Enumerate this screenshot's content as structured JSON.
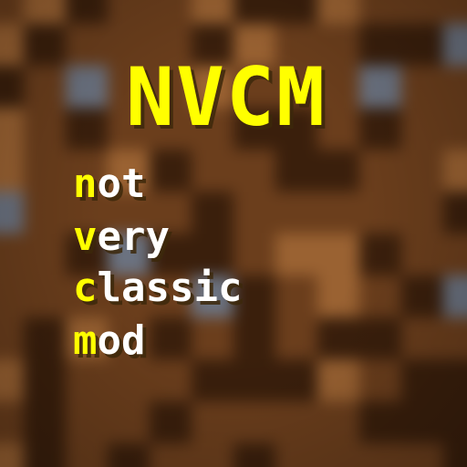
{
  "title": "NVCM",
  "words": [
    {
      "first": "n",
      "rest": "ot"
    },
    {
      "first": "v",
      "rest": "ery"
    },
    {
      "first": "c",
      "rest": "lassic"
    },
    {
      "first": "m",
      "rest": "od"
    }
  ],
  "colors": {
    "title": "#ffff00",
    "accent": "#ffff00",
    "text": "#ffffff",
    "dirt_dark": "#3a1f0c",
    "dirt_mid": "#6b3e1c",
    "dirt_light": "#9a6232",
    "stone": "#6b7280"
  }
}
